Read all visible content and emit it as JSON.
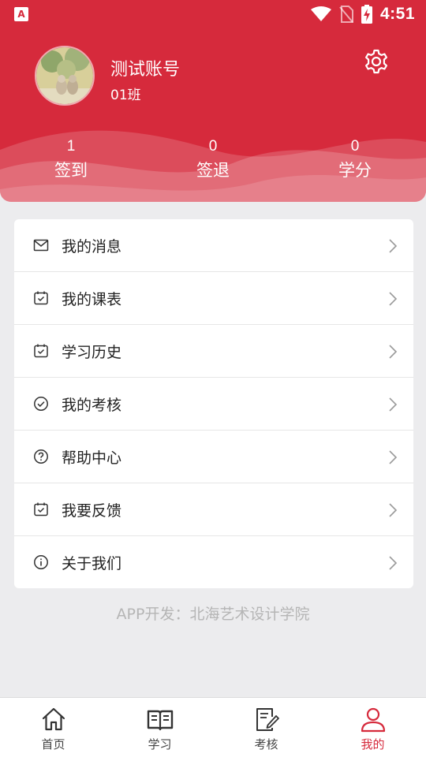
{
  "status_bar": {
    "time": "4:51",
    "app_badge": "A"
  },
  "profile": {
    "name": "测试账号",
    "class": "01班"
  },
  "stats": [
    {
      "value": "1",
      "label": "签到"
    },
    {
      "value": "0",
      "label": "签退"
    },
    {
      "value": "0",
      "label": "学分"
    }
  ],
  "menu": [
    {
      "label": "我的消息",
      "icon": "mail-icon"
    },
    {
      "label": "我的课表",
      "icon": "calendar-check-icon"
    },
    {
      "label": "学习历史",
      "icon": "calendar-check-icon"
    },
    {
      "label": "我的考核",
      "icon": "check-circle-icon"
    },
    {
      "label": "帮助中心",
      "icon": "help-circle-icon"
    },
    {
      "label": "我要反馈",
      "icon": "calendar-check-icon"
    },
    {
      "label": "关于我们",
      "icon": "info-circle-icon"
    }
  ],
  "footer": "APP开发：北海艺术设计学院",
  "bottom_nav": [
    {
      "label": "首页",
      "icon": "home-icon",
      "active": false
    },
    {
      "label": "学习",
      "icon": "book-icon",
      "active": false
    },
    {
      "label": "考核",
      "icon": "exam-edit-icon",
      "active": false
    },
    {
      "label": "我的",
      "icon": "user-icon",
      "active": true
    }
  ],
  "colors": {
    "brand": "#d62a3c",
    "background": "#ececee",
    "card": "#ffffff",
    "muted": "#b5b5b5"
  }
}
